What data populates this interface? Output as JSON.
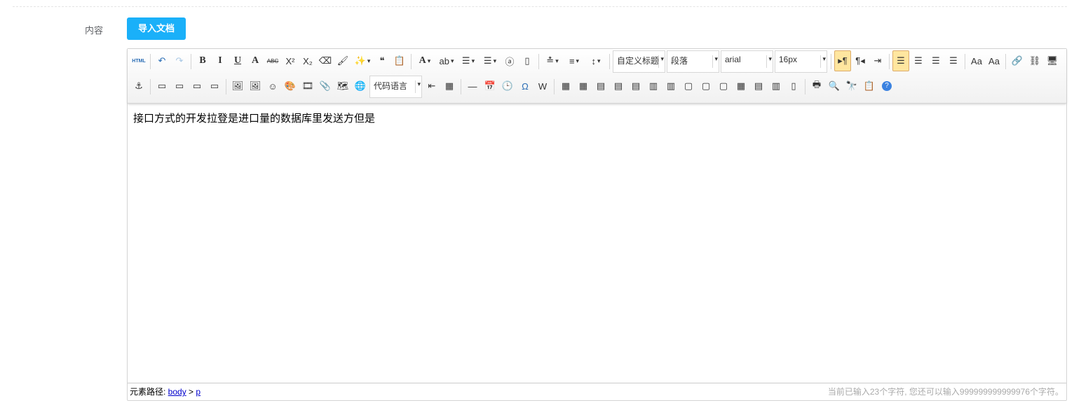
{
  "form": {
    "label": "内容",
    "import_button": "导入文档"
  },
  "toolbar": {
    "row1a": [
      {
        "n": "source",
        "g": "HTML"
      },
      {
        "sep": 1
      },
      {
        "n": "undo",
        "g": "↶"
      },
      {
        "n": "redo",
        "g": "↷"
      },
      {
        "sep": 1
      },
      {
        "n": "bold",
        "g": "B"
      },
      {
        "n": "italic",
        "g": "I"
      },
      {
        "n": "underline",
        "g": "U"
      },
      {
        "n": "fontborder",
        "g": "A"
      },
      {
        "n": "strikethrough",
        "g": "ABC"
      },
      {
        "n": "superscript",
        "g": "X²"
      },
      {
        "n": "subscript",
        "g": "X₂"
      },
      {
        "n": "removeformat",
        "g": "⌫"
      },
      {
        "n": "formatmatch",
        "g": "🖌"
      },
      {
        "n": "autotypeset",
        "g": "✨",
        "dd": 1
      },
      {
        "n": "blockquote",
        "g": "❝"
      },
      {
        "n": "pasteplain",
        "g": "📋"
      },
      {
        "sep": 1
      },
      {
        "n": "forecolor",
        "g": "A",
        "dd": 1
      },
      {
        "n": "backcolor",
        "g": "ab",
        "dd": 1
      },
      {
        "n": "ordered-list",
        "g": "☰",
        "dd": 1
      },
      {
        "n": "unordered-list",
        "g": "☰",
        "dd": 1
      },
      {
        "n": "selectall",
        "g": "ⓐ"
      },
      {
        "n": "cleardoc",
        "g": "▯"
      },
      {
        "sep": 1
      },
      {
        "n": "rowspacing-top",
        "g": "≛",
        "dd": 1
      },
      {
        "n": "rowspacing-bottom",
        "g": "≡",
        "dd": 1
      },
      {
        "n": "lineheight",
        "g": "↕",
        "dd": 1
      },
      {
        "sep": 1
      }
    ],
    "selects1": [
      {
        "n": "customstyle",
        "v": "自定义标题",
        "w": 75
      },
      {
        "n": "paragraph",
        "v": "段落",
        "w": 75
      },
      {
        "n": "fontfamily",
        "v": "arial",
        "w": 75
      },
      {
        "n": "fontsize",
        "v": "16px",
        "w": 75
      }
    ],
    "row1b": [
      {
        "sep": 1
      },
      {
        "n": "direction-ltr",
        "g": "▸¶",
        "on": 1
      },
      {
        "n": "direction-rtl",
        "g": "¶◂"
      },
      {
        "n": "indent",
        "g": "⇥"
      },
      {
        "sep": 1
      },
      {
        "n": "justify-left",
        "g": "☰",
        "on": 1
      },
      {
        "n": "justify-center",
        "g": "☰"
      },
      {
        "n": "justify-right",
        "g": "☰"
      },
      {
        "n": "justify-full",
        "g": "☰"
      },
      {
        "sep": 1
      },
      {
        "n": "touppercase",
        "g": "Aa"
      },
      {
        "n": "tolowercase",
        "g": "Aa"
      },
      {
        "sep": 1
      },
      {
        "n": "link",
        "g": "🔗"
      },
      {
        "n": "unlink",
        "g": "⛓"
      },
      {
        "n": "insertframe",
        "g": "🖥"
      }
    ],
    "row2a": [
      {
        "n": "anchor",
        "g": "⚓"
      },
      {
        "sep": 1
      },
      {
        "n": "image-none",
        "g": "▭"
      },
      {
        "n": "image-left",
        "g": "▭"
      },
      {
        "n": "image-right",
        "g": "▭"
      },
      {
        "n": "image-center",
        "g": "▭"
      },
      {
        "sep": 1
      },
      {
        "n": "simpleupload",
        "g": "🖼"
      },
      {
        "n": "insertimage",
        "g": "🖼"
      },
      {
        "n": "emotion",
        "g": "☺"
      },
      {
        "n": "scrawl",
        "g": "🎨"
      },
      {
        "n": "insertvideo",
        "g": "🎞"
      },
      {
        "n": "attachment",
        "g": "📎"
      },
      {
        "n": "map",
        "g": "🗺"
      },
      {
        "n": "webapp",
        "g": "🌐"
      }
    ],
    "code_select": {
      "n": "insertcode",
      "v": "代码语言",
      "w": 75
    },
    "row2b": [
      {
        "n": "pagebreak",
        "g": "⇤"
      },
      {
        "n": "template",
        "g": "▦"
      },
      {
        "sep": 1
      },
      {
        "n": "horizontal",
        "g": "—"
      },
      {
        "n": "date",
        "g": "📅"
      },
      {
        "n": "time",
        "g": "🕒"
      },
      {
        "n": "spechars",
        "g": "Ω"
      },
      {
        "n": "wordimage",
        "g": "W"
      },
      {
        "sep": 1
      },
      {
        "n": "inserttable",
        "g": "▦"
      },
      {
        "n": "deletetable",
        "g": "▦"
      },
      {
        "n": "insert-paragraph-before-table",
        "g": "▤"
      },
      {
        "n": "insertrow",
        "g": "▤"
      },
      {
        "n": "deleterow",
        "g": "▤"
      },
      {
        "n": "insertcol",
        "g": "▥"
      },
      {
        "n": "deletecol",
        "g": "▥"
      },
      {
        "n": "mergecells",
        "g": "▢"
      },
      {
        "n": "mergeright",
        "g": "▢"
      },
      {
        "n": "mergedown",
        "g": "▢"
      },
      {
        "n": "splittocells",
        "g": "▦"
      },
      {
        "n": "splittorows",
        "g": "▤"
      },
      {
        "n": "splittocols",
        "g": "▥"
      },
      {
        "n": "charts",
        "g": "▯"
      },
      {
        "sep": 1
      },
      {
        "n": "print",
        "g": "🖶"
      },
      {
        "n": "preview",
        "g": "🔍"
      },
      {
        "n": "searchreplace",
        "g": "🔭"
      },
      {
        "n": "drafts",
        "g": "📋"
      },
      {
        "n": "help",
        "g": "?"
      }
    ]
  },
  "content": {
    "text": "接口方式的开发拉登是进口量的数据库里发送方但是"
  },
  "footer": {
    "path_label": "元素路径: ",
    "path_body": "body",
    "path_sep": " > ",
    "path_p": "p",
    "count": "当前已输入23个字符, 您还可以输入999999999999976个字符。"
  }
}
